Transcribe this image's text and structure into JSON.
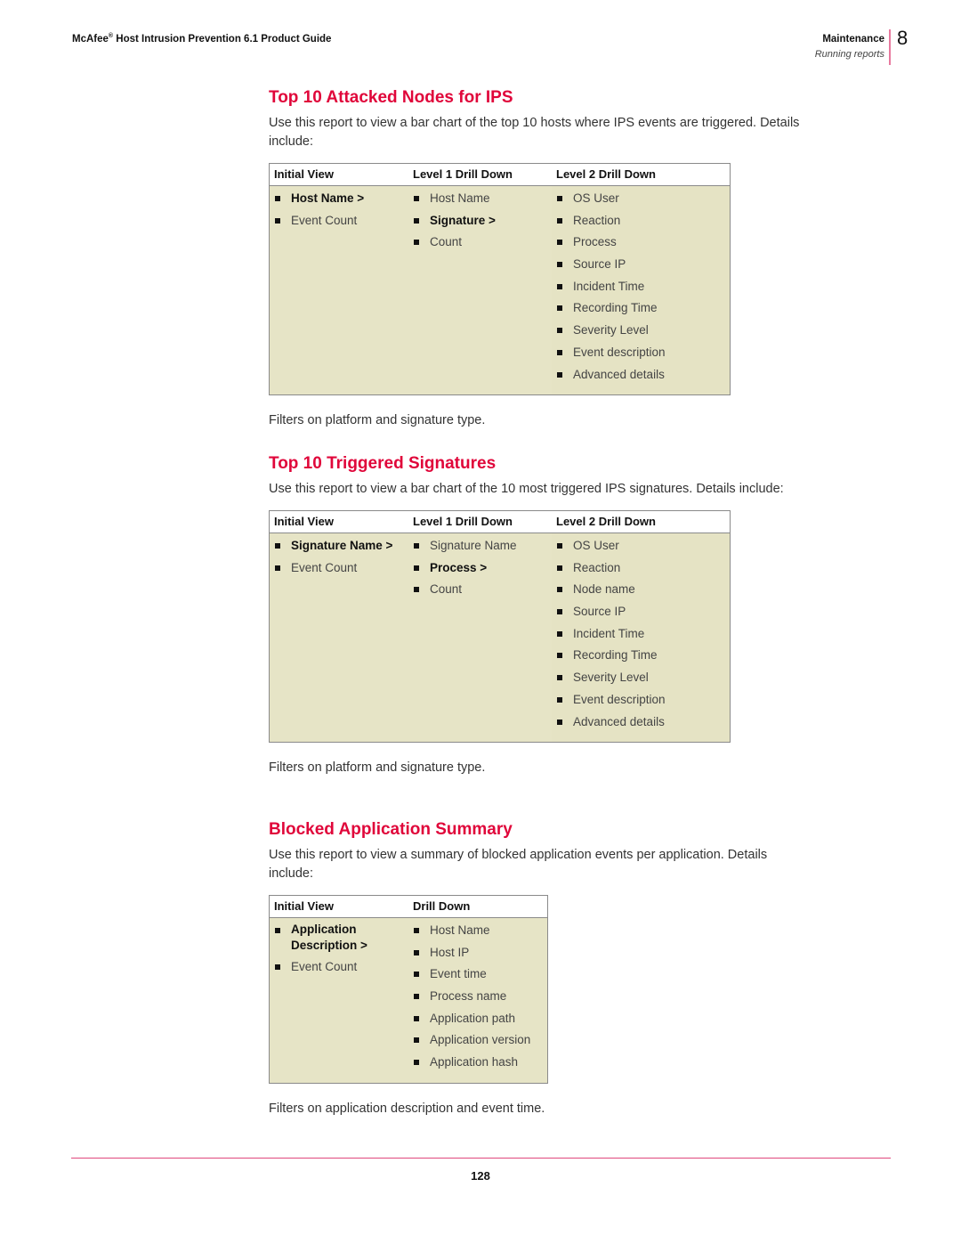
{
  "header": {
    "brand": "McAfee",
    "registered_mark": "®",
    "doc_title": "Host Intrusion Prevention 6.1 Product Guide",
    "section": "Maintenance",
    "subsection": "Running reports",
    "chapter_number": "8"
  },
  "sections": [
    {
      "title": "Top 10 Attacked Nodes for IPS",
      "intro": "Use this report to view a bar chart of the top 10 hosts where IPS events are triggered. Details include:",
      "table": {
        "headers": [
          "Initial View",
          "Level 1 Drill Down",
          "Level 2 Drill Down"
        ],
        "columns": [
          [
            {
              "text": "Host Name >",
              "bold": true
            },
            {
              "text": "Event Count",
              "bold": false
            }
          ],
          [
            {
              "text": "Host Name",
              "bold": false
            },
            {
              "text": "Signature >",
              "bold": true
            },
            {
              "text": "Count",
              "bold": false
            }
          ],
          [
            {
              "text": "OS User"
            },
            {
              "text": "Reaction"
            },
            {
              "text": "Process"
            },
            {
              "text": "Source IP"
            },
            {
              "text": "Incident Time"
            },
            {
              "text": "Recording Time"
            },
            {
              "text": "Severity Level"
            },
            {
              "text": "Event description"
            },
            {
              "text": "Advanced details"
            }
          ]
        ]
      },
      "filter_note": "Filters on platform and signature type."
    },
    {
      "title": "Top 10 Triggered Signatures",
      "intro": "Use this report to view a bar chart of the 10 most triggered IPS signatures. Details include:",
      "table": {
        "headers": [
          "Initial View",
          "Level 1 Drill Down",
          "Level 2 Drill Down"
        ],
        "columns": [
          [
            {
              "text": "Signature Name >",
              "bold": true
            },
            {
              "text": "Event Count",
              "bold": false
            }
          ],
          [
            {
              "text": "Signature Name",
              "bold": false
            },
            {
              "text": "Process >",
              "bold": true
            },
            {
              "text": "Count",
              "bold": false
            }
          ],
          [
            {
              "text": "OS User"
            },
            {
              "text": "Reaction"
            },
            {
              "text": "Node name"
            },
            {
              "text": "Source IP"
            },
            {
              "text": "Incident Time"
            },
            {
              "text": "Recording Time"
            },
            {
              "text": "Severity Level"
            },
            {
              "text": "Event description"
            },
            {
              "text": "Advanced details"
            }
          ]
        ]
      },
      "filter_note": "Filters on platform and signature type."
    },
    {
      "title": "Blocked Application Summary",
      "intro": "Use this report to view a summary of blocked application events per application. Details include:",
      "table": {
        "headers": [
          "Initial View",
          "Drill Down"
        ],
        "columns": [
          [
            {
              "text": "Application Description >",
              "bold": true
            },
            {
              "text": "Event Count",
              "bold": false
            }
          ],
          [
            {
              "text": "Host Name"
            },
            {
              "text": "Host IP"
            },
            {
              "text": "Event time"
            },
            {
              "text": "Process name"
            },
            {
              "text": "Application path"
            },
            {
              "text": "Application version"
            },
            {
              "text": "Application hash"
            }
          ]
        ]
      },
      "filter_note": "Filters on application description and event time."
    }
  ],
  "footer": {
    "page_number": "128"
  },
  "colors": {
    "heading": "#e0063a",
    "table_fill": "#e6e4c6",
    "rule": "#e0487c"
  }
}
